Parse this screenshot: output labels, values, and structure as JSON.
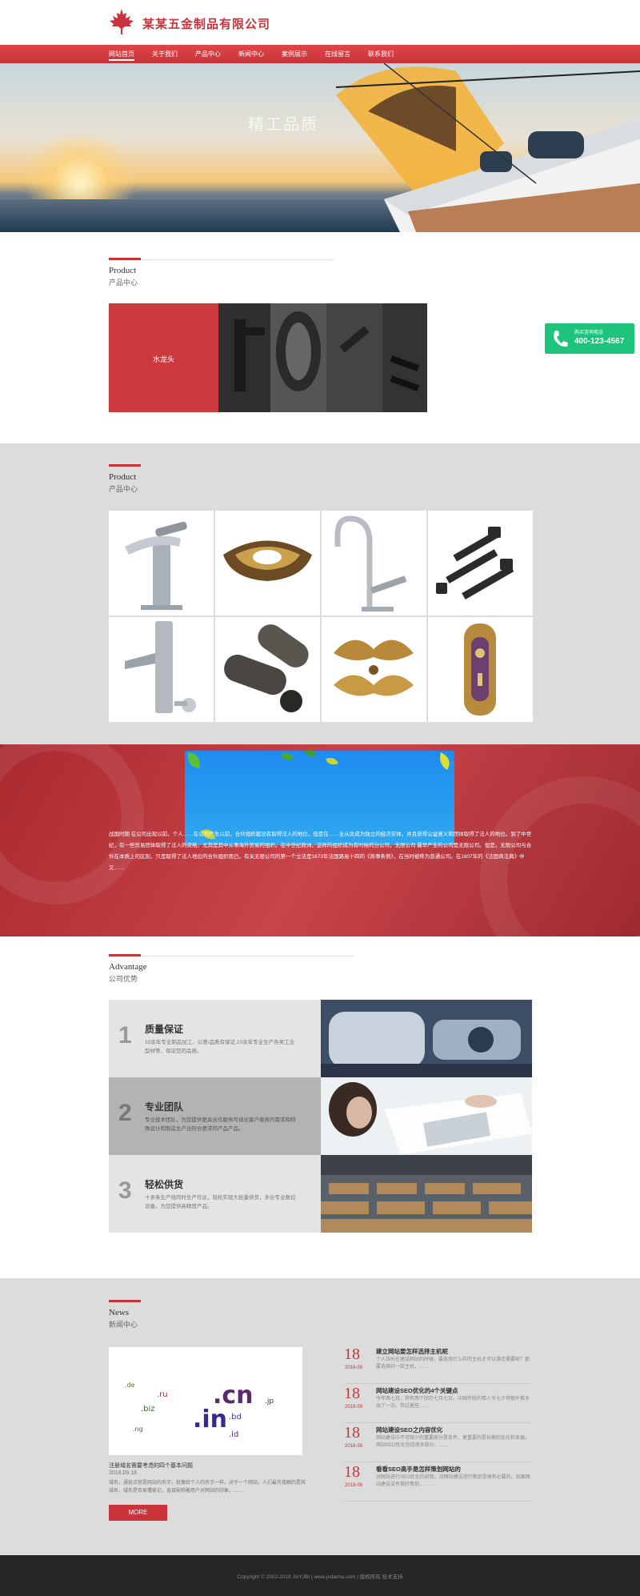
{
  "header": {
    "company_name": "某某五金制品有限公司"
  },
  "nav": {
    "items": [
      "网站首页",
      "关于我们",
      "产品中心",
      "新闻中心",
      "案例展示",
      "在线留言",
      "联系我们"
    ]
  },
  "banner": {
    "title": "精工品质",
    "subtitle": ""
  },
  "product_slider": {
    "heading_en": "Product",
    "heading_cn": "产品中心",
    "slide_label": "水龙头"
  },
  "callout": {
    "label": "购买咨询电话",
    "phone": "400-123-4567"
  },
  "product_grid": {
    "heading_en": "Product",
    "heading_cn": "产品中心",
    "items": [
      "faucet",
      "ornate-handle",
      "gooseneck-faucet",
      "bolts",
      "sensor-faucet",
      "metal-tubes",
      "gold-ornament",
      "door-lock"
    ]
  },
  "about": {
    "text": "战国时期 在公司出现以前，个人……在公司产生以前，合伙组织都没有取得法人的地位，但是在……业从此成为独立的经济实体，并且获得公益意义和团体取得了法人的地位。到了中世纪，有一些贸易团体取得了法人的资格，尤其是其中从事海外贸易的组织。在中世纪欧洲，这样的组织成为有时候的分公司，无限公司 最早产生的公司是无限公司。但是，无限公司与合伙在本质上的区别，只是取得了法人地位的合伙组织而已。有关无限公司的第一个立法是1673年法国路易十四的《商事条例》，在当时被称为普通公司。在1807年的《法国商法典》中又……"
  },
  "advantage": {
    "heading_en": "Advantage",
    "heading_cn": "公司优势",
    "items": [
      {
        "num": "1",
        "title": "质量保证",
        "desc": "10余年专业制品加工，公差/品质有保证,10余年专业生产各类工业型材等，保证您的品质。"
      },
      {
        "num": "2",
        "title": "专业团队",
        "desc": "专业技术团队，为您提供更具合作服务可视化客户服务的需求和特殊设计和制造生产出符合要求的产品产品。"
      },
      {
        "num": "3",
        "title": "轻松供货",
        "desc": "十多条生产线同时生产作业，轻松实现大批量供货，多台专业数控设备，为您提供高精度产品。"
      }
    ]
  },
  "news": {
    "heading_en": "News",
    "heading_cn": "新闻中心",
    "main": {
      "title": "注册域名需要考虑的四个基本问题",
      "date": "2018.09.18",
      "desc": "域名，通俗点就是网站的名字，就像给个人的名字一样。对于一个网站，人们最先接触的是其域名，域名是否易懂易记，直接影响着用户对网站的印象，……",
      "more": "MORE"
    },
    "items": [
      {
        "day": "18",
        "ym": "2018-09",
        "title": "建立网站要怎样选择主机呢",
        "desc": "个人站长在建设网站的时候，要选择什么样的主机才可以满足需要呢？那要选择好一款主机，……"
      },
      {
        "day": "18",
        "ym": "2018-09",
        "title": "网站建设SEO优化的4个关键点",
        "desc": "今年两七月，将有两个阴历七月七日，中国传统的情人节七夕将额外推多出了一次。但过着些……"
      },
      {
        "day": "18",
        "ym": "2018-09",
        "title": "网站建设SEO之内容优化",
        "desc": "网站建设中不可缺少的重要部分是条件，更重要的是长期的优化和发展。网站SEO优化包括很多部分，……"
      },
      {
        "day": "18",
        "ym": "2018-09",
        "title": "看看SEO高手是怎样策划网站的",
        "desc": "对网站进行SEO优化的初期，对网站建设进行策划是很有必要的。如果网站建设没有做好策划，……"
      }
    ]
  },
  "footer": {
    "text": "Copyright © 2002-2018 JixYJBI | www.jxdaima.com | 版权所有 技术支持"
  }
}
